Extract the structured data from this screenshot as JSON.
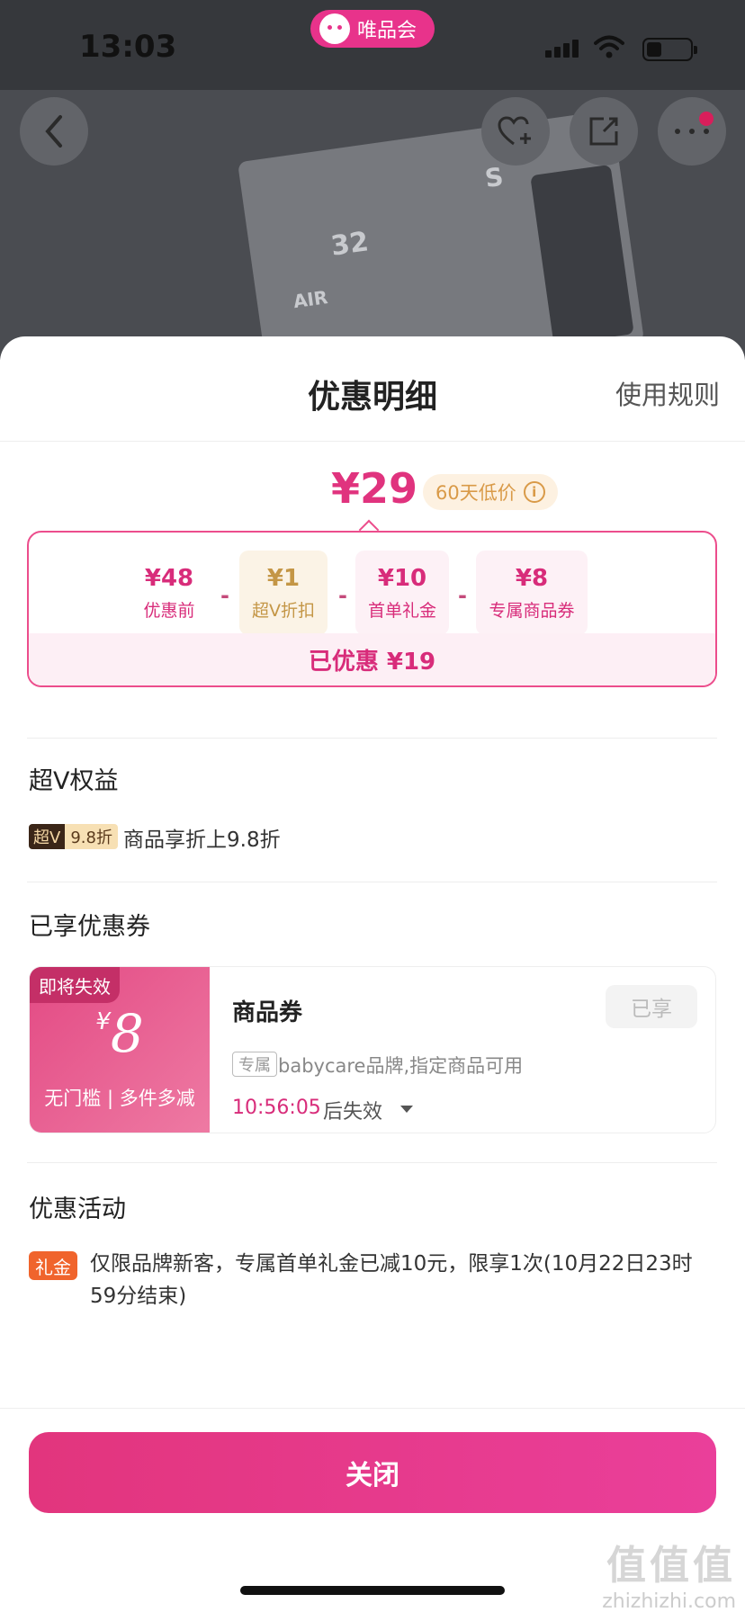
{
  "status_bar": {
    "time": "13:03",
    "app_badge": "唯品会"
  },
  "sheet": {
    "title": "优惠明细",
    "rules_link": "使用规则",
    "final_price": "¥29",
    "low_price_tag": "60天低价",
    "breakdown": [
      {
        "value": "¥48",
        "label": "优惠前"
      },
      {
        "value": "¥1",
        "label": "超V折扣"
      },
      {
        "value": "¥10",
        "label": "首单礼金"
      },
      {
        "value": "¥8",
        "label": "专属商品券"
      }
    ],
    "minus_sign": "-",
    "saved_total": "已优惠 ¥19"
  },
  "super_v": {
    "section_title": "超V权益",
    "tag_left": "超V",
    "tag_right": "9.8折",
    "text": "商品享折上9.8折"
  },
  "coupons": {
    "section_title": "已享优惠券",
    "coupon": {
      "expire_tag": "即将失效",
      "currency": "¥",
      "amount": "8",
      "condition": "无门槛 | 多件多减",
      "name": "商品券",
      "status_button": "已享",
      "exclusive_tag": "专属",
      "description": "babycare品牌,指定商品可用",
      "countdown": "10:56:05",
      "countdown_suffix": "后失效"
    }
  },
  "activities": {
    "section_title": "优惠活动",
    "tag": "礼金",
    "text": "仅限品牌新客，专属首单礼金已减10元，限享1次(10月22日23时59分结束)"
  },
  "close_button": "关闭",
  "watermark": {
    "main": "值值值",
    "sub": "zhizhizhi.com"
  }
}
